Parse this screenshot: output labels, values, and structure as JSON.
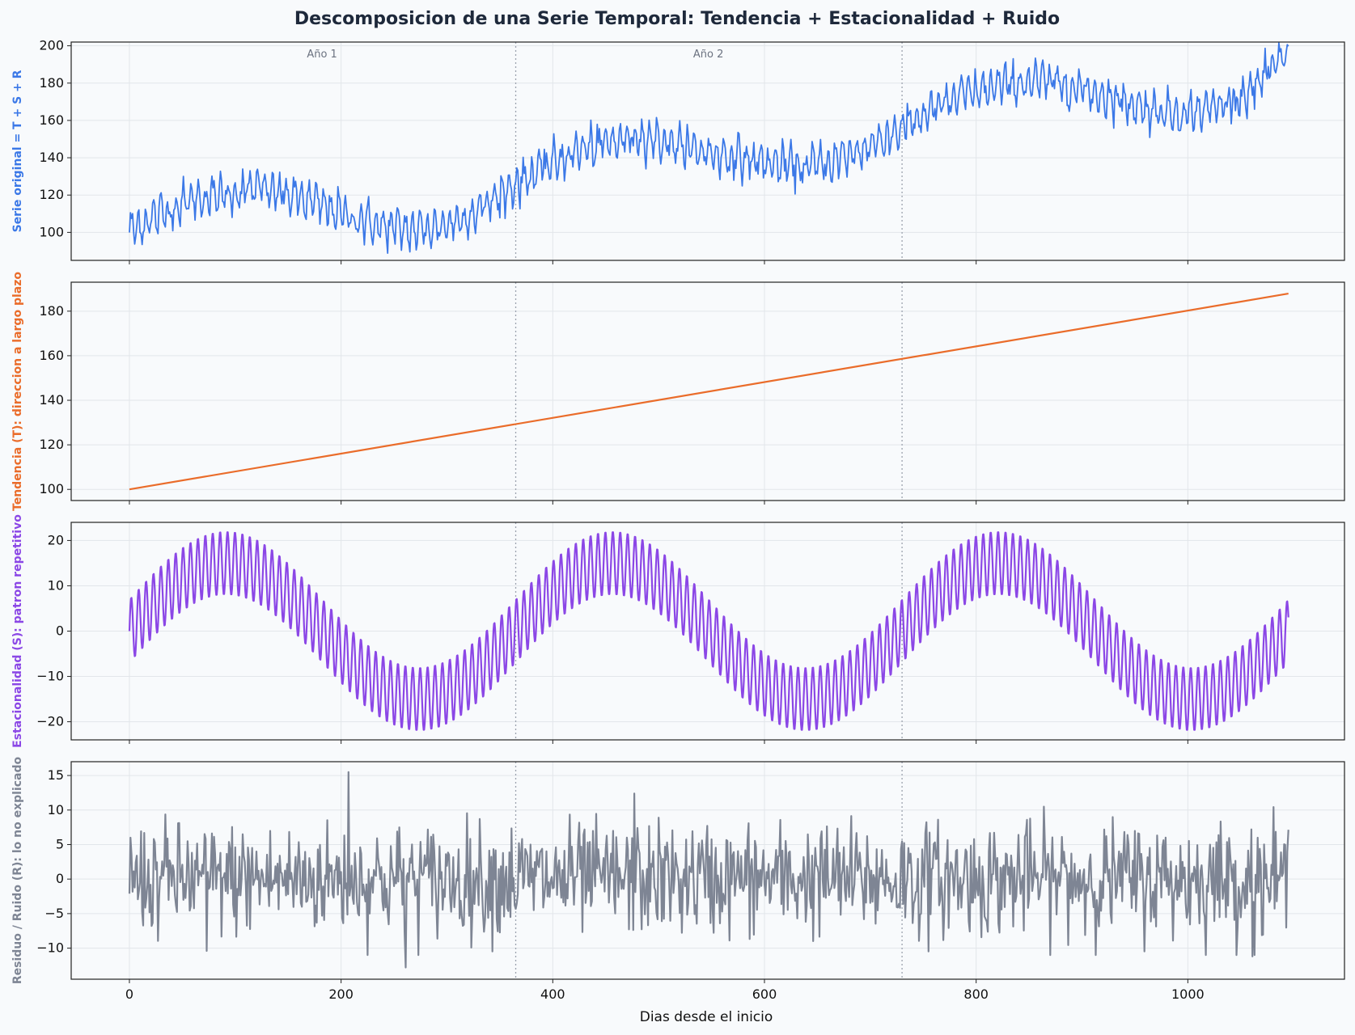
{
  "figure_title": "Descomposicion de una Serie Temporal: Tendencia + Estacionalidad + Ruido",
  "xlabel": "Dias desde el inicio",
  "xlim": [
    -55,
    1148
  ],
  "xticks": [
    0,
    200,
    400,
    600,
    800,
    1000
  ],
  "year_boundaries": [
    365,
    730
  ],
  "year_labels": [
    {
      "text": "Año 1",
      "x": 182
    },
    {
      "text": "Año 2",
      "x": 547
    }
  ],
  "chart_data": [
    {
      "type": "line",
      "name": "original",
      "ylabel": "Serie original = T + S + R",
      "color": "#3b78e7",
      "ylim": [
        85,
        202
      ],
      "yticks": [
        100,
        120,
        140,
        160,
        180,
        200
      ],
      "x": [
        0,
        30,
        60,
        90,
        120,
        150,
        180,
        210,
        240,
        270,
        300,
        330,
        365,
        395,
        425,
        455,
        485,
        515,
        545,
        575,
        605,
        635,
        665,
        695,
        730,
        760,
        790,
        820,
        850,
        880,
        910,
        940,
        970,
        1000,
        1030,
        1060,
        1095
      ],
      "y": [
        101,
        110,
        118,
        120,
        124,
        120,
        115,
        108,
        103,
        101,
        104,
        112,
        126,
        136,
        144,
        148,
        152,
        147,
        143,
        140,
        137,
        135,
        138,
        145,
        156,
        166,
        174,
        178,
        181,
        180,
        175,
        170,
        165,
        164,
        168,
        176,
        196
      ],
      "oscillation_amplitude": 10
    },
    {
      "type": "line",
      "name": "trend",
      "ylabel": "Tendencia (T): direccion a largo plazo",
      "color": "#ea6c2a",
      "ylim": [
        95,
        193
      ],
      "yticks": [
        100,
        120,
        140,
        160,
        180
      ],
      "x": [
        0,
        1095
      ],
      "y": [
        100,
        187.9
      ]
    },
    {
      "type": "line",
      "name": "seasonal",
      "ylabel": "Estacionalidad (S): patron repetitivo",
      "color": "#8b47e6",
      "ylim": [
        -24,
        24
      ],
      "yticks": [
        -20,
        -10,
        0,
        10,
        20
      ],
      "annual_amplitude": 15,
      "annual_period_days": 365,
      "weekly_amplitude": 7,
      "weekly_period_days": 7,
      "x_range": [
        0,
        1095
      ]
    },
    {
      "type": "line",
      "name": "residual",
      "ylabel": "Residuo / Ruido (R): lo no explicado",
      "color": "#7e8594",
      "ylim": [
        -14.5,
        17
      ],
      "yticks": [
        -10,
        -5,
        0,
        5,
        10,
        15
      ],
      "x_range": [
        0,
        1095
      ],
      "std": 4,
      "notable_points": [
        {
          "x": 207,
          "y": 15.5
        },
        {
          "x": 261,
          "y": -12.8
        },
        {
          "x": 477,
          "y": 12.4
        },
        {
          "x": 1061,
          "y": -11.2
        },
        {
          "x": 73,
          "y": -10.4
        }
      ]
    }
  ]
}
